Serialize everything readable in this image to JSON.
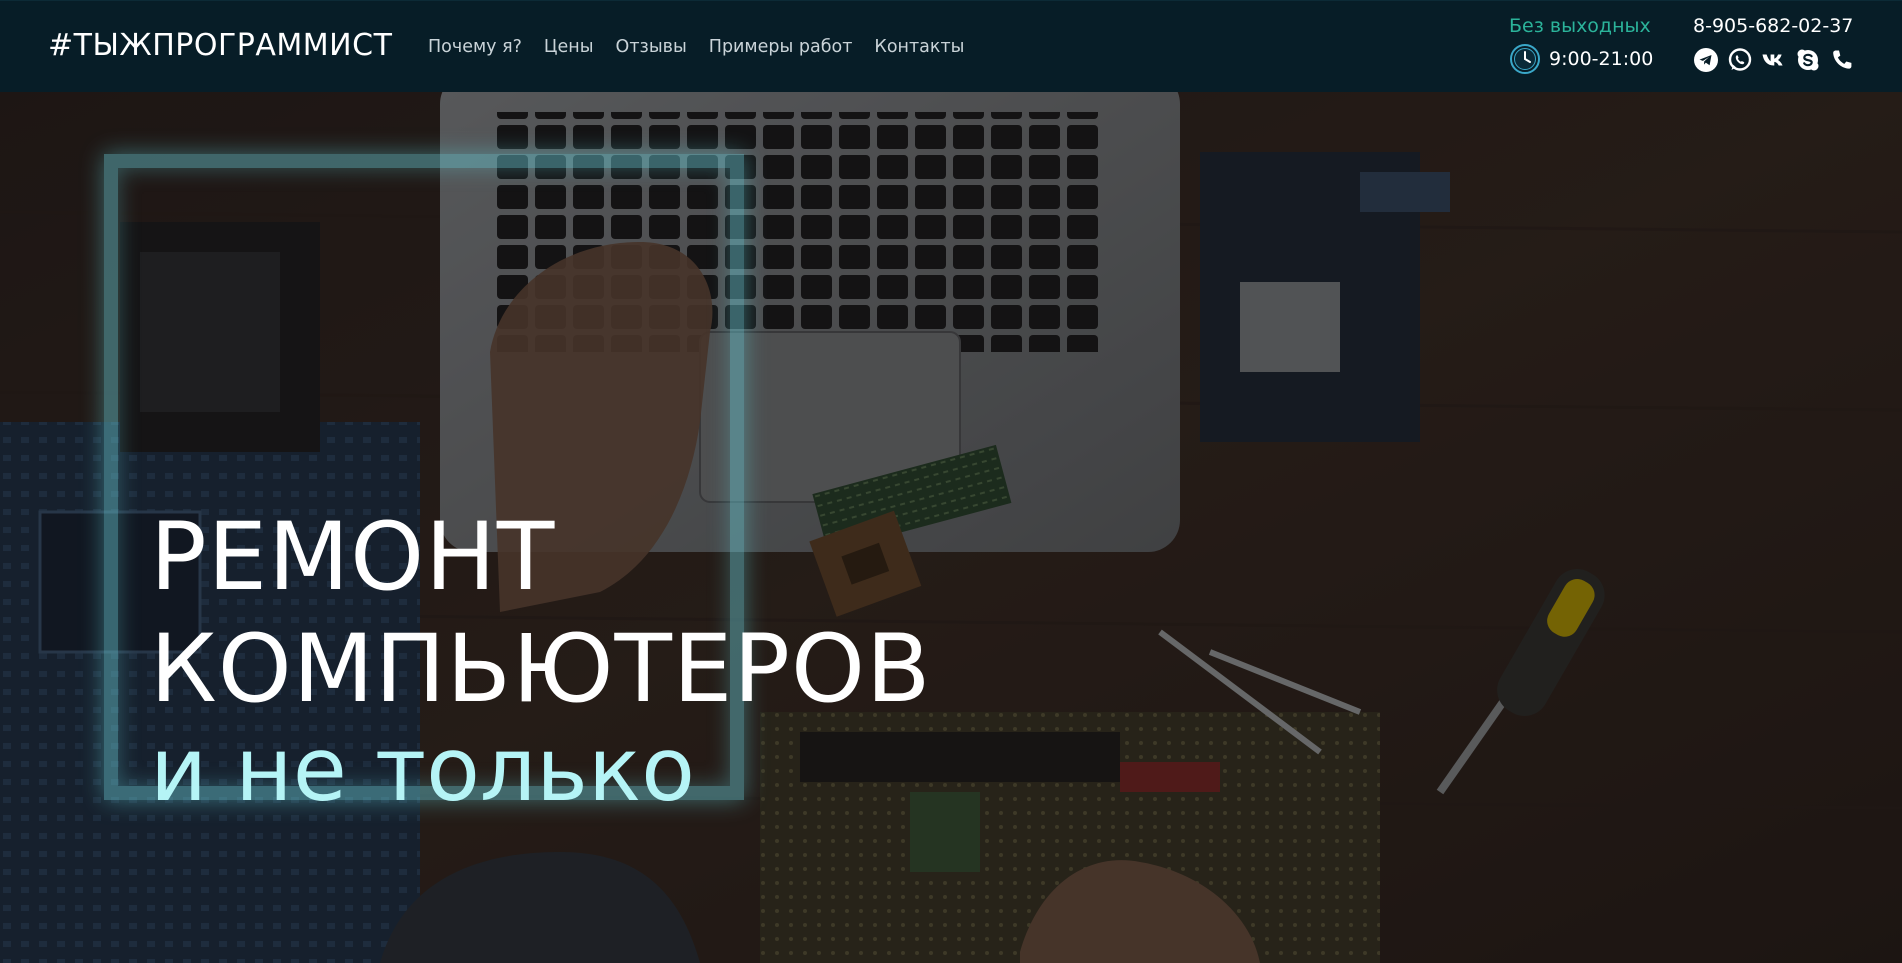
{
  "header": {
    "logo": "#ТЫЖПРОГРАММИСТ",
    "nav": [
      {
        "label": "Почему я?"
      },
      {
        "label": "Цены"
      },
      {
        "label": "Отзывы"
      },
      {
        "label": "Примеры работ"
      },
      {
        "label": "Контакты"
      }
    ],
    "schedule": {
      "label": "Без выходных",
      "hours": "9:00-21:00",
      "icon": "clock-icon"
    },
    "phone": "8-905-682-02-37",
    "socials": [
      {
        "name": "telegram-icon"
      },
      {
        "name": "whatsapp-icon"
      },
      {
        "name": "vk-icon"
      },
      {
        "name": "skype-icon"
      },
      {
        "name": "phone-icon"
      }
    ]
  },
  "hero": {
    "title_line1": "РЕМОНТ",
    "title_line2": "КОМПЬЮТЕРОВ",
    "subtitle": "и не только"
  },
  "colors": {
    "header_bg": "#071d27",
    "accent_green": "#2bb39a",
    "subtitle_cyan": "#b5f4f6",
    "frame_glow": "#68c8d2"
  }
}
